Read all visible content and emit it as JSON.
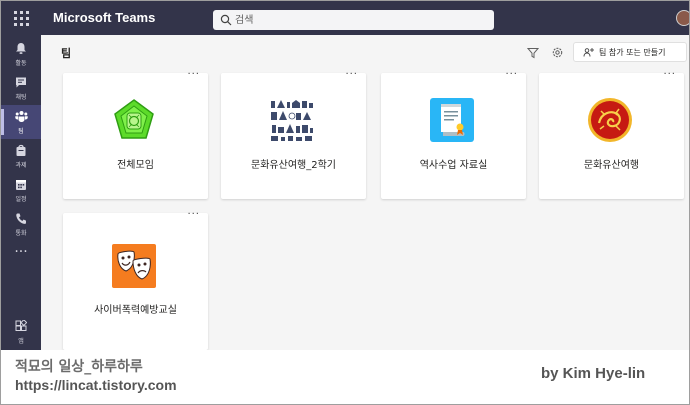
{
  "app": {
    "name": "Microsoft Teams"
  },
  "search": {
    "placeholder": "검색"
  },
  "rail": {
    "items": [
      {
        "label": "활동",
        "icon": "bell-icon"
      },
      {
        "label": "채팅",
        "icon": "chat-icon"
      },
      {
        "label": "팀",
        "icon": "teams-icon",
        "active": true
      },
      {
        "label": "과제",
        "icon": "assignments-icon"
      },
      {
        "label": "일정",
        "icon": "calendar-icon"
      },
      {
        "label": "통화",
        "icon": "phone-icon"
      }
    ],
    "more": "···",
    "apps_label": "앱"
  },
  "header": {
    "title": "팀",
    "join_button": "팀 참가 또는 만들기"
  },
  "teams": [
    {
      "name": "전체모임",
      "logo": "green-emblem"
    },
    {
      "name": "문화유산여행_2학기",
      "logo": "heritage-collage"
    },
    {
      "name": "역사수업 자료실",
      "logo": "scroll-document-icon"
    },
    {
      "name": "문화유산여행",
      "logo": "red-dragon-seal"
    },
    {
      "name": "사이버폭력예방교실",
      "logo": "theater-masks-icon"
    }
  ],
  "card_more": "···",
  "watermark": {
    "title": "적묘의 일상_하루하루",
    "url": "https://lincat.tistory.com",
    "author": "by Kim Hye-lin"
  },
  "colors": {
    "top_bar": "#33344a",
    "rail_active": "#464775",
    "content_bg": "#f5f5f5",
    "scroll_logo": "#29b6f6",
    "masks_logo": "#f57c1f"
  }
}
